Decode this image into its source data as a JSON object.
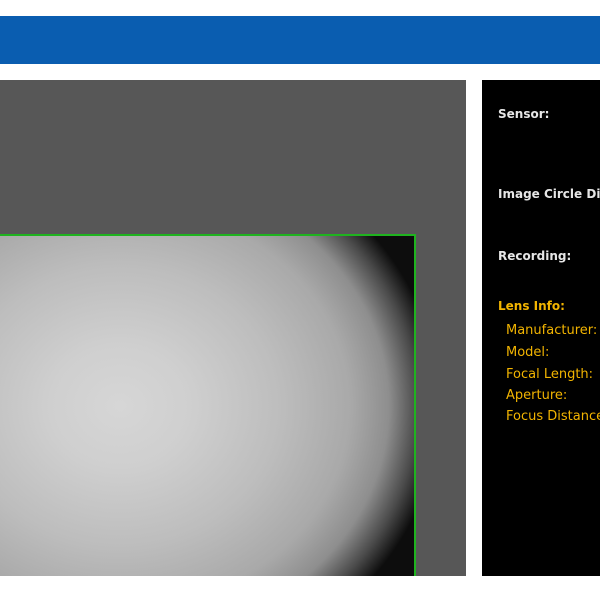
{
  "header": {
    "bar_color": "#0a5db0"
  },
  "viewer": {
    "background_color": "#575757",
    "frame_color": "#1fb31f"
  },
  "info": {
    "sensor_label": "Sensor:",
    "image_circle_label": "Image Circle Diameter:",
    "recording_label": "Recording:",
    "lens_info_label": "Lens Info:",
    "lens_fields": [
      {
        "label": "Manufacturer:"
      },
      {
        "label": "Model:"
      },
      {
        "label": "Focal Length:"
      },
      {
        "label": "Aperture:"
      },
      {
        "label": "Focus Distance:"
      }
    ],
    "accent_color": "#f2b400"
  }
}
